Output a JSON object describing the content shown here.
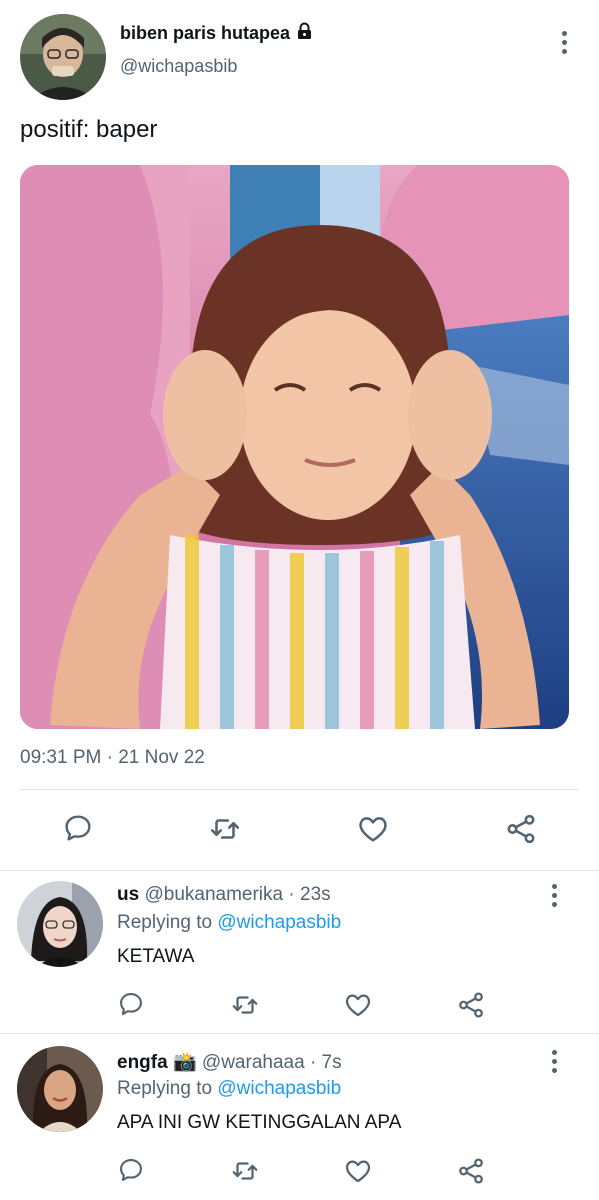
{
  "tweet": {
    "author_name": "biben paris hutapea",
    "author_handle": "@wichapasbib",
    "text": "positif: baper",
    "timestamp": "09:31 PM · 21 Nov 22",
    "lock_icon": "lock-icon",
    "actions": [
      "reply-icon",
      "retweet-icon",
      "like-icon",
      "share-icon"
    ]
  },
  "replies": [
    {
      "name": "us",
      "handle": "@bukanamerika",
      "time": "· 23s",
      "replying_label": "Replying to",
      "replying_to": "@wichapasbib",
      "text": "KETAWA"
    },
    {
      "name": "engfa",
      "emoji": "📸",
      "handle": "@warahaaa",
      "time": "· 7s",
      "replying_label": "Replying to",
      "replying_to": "@wichapasbib",
      "text": "APA INI GW KETINGGALAN APA"
    }
  ],
  "colors": {
    "text": "#0f1419",
    "muted": "#536471",
    "link": "#1d9bf0",
    "divider": "#e1e6ea"
  }
}
